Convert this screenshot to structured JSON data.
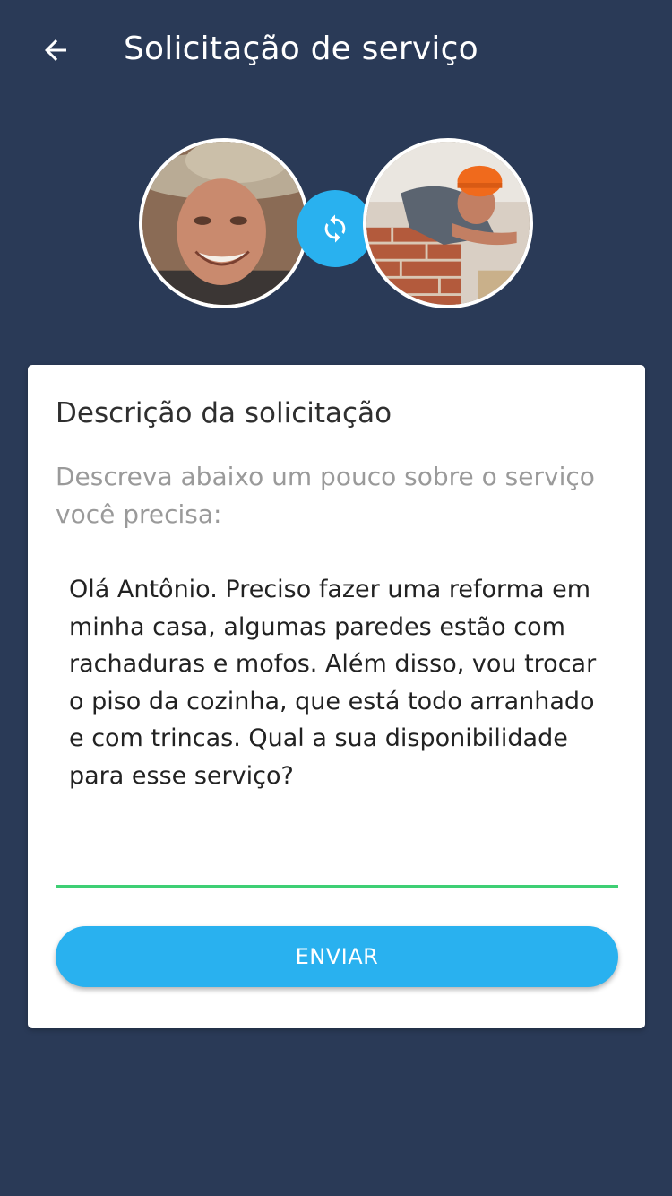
{
  "header": {
    "title": "Solicitação de serviço",
    "back_icon": "arrow-left-icon"
  },
  "avatars": {
    "swap_icon": "sync-icon",
    "accent_color": "#29b1ef"
  },
  "form": {
    "title": "Descrição da solicitação",
    "hint": "Descreva abaixo um pouco sobre o serviço você precisa:",
    "description_value": "Olá Antônio. Preciso fazer uma reforma em minha casa, algumas paredes estão com rachaduras e mofos. Além disso, vou trocar o piso da cozinha, que está todo arranhado e com trincas. Qual a sua disponibilidade para esse serviço?",
    "underline_color": "#3ecf74",
    "submit_label": "ENVIAR"
  },
  "colors": {
    "background": "#2a3a57",
    "card": "#ffffff",
    "button": "#29b1ef"
  }
}
